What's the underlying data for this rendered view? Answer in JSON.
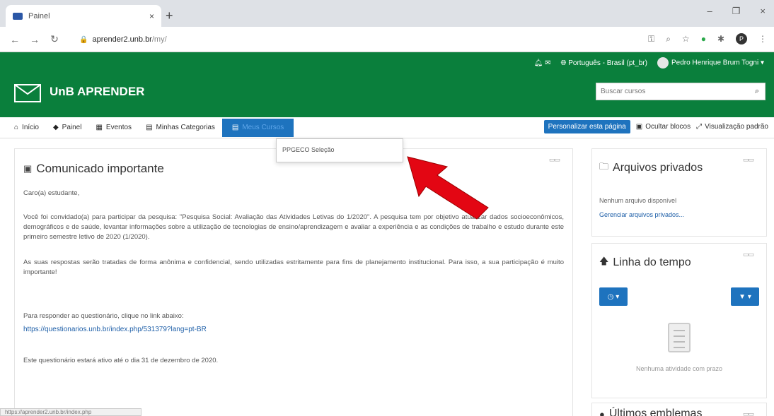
{
  "browser": {
    "tab_title": "Painel",
    "tab_close": "×",
    "new_tab": "+",
    "url_host": "aprender2.unb.br",
    "url_path": "/my/",
    "win_minimize": "–",
    "win_restore": "❐",
    "win_close": "×",
    "profile_initial": "P"
  },
  "header": {
    "language": "Português - Brasil (pt_br)",
    "user_name": "Pedro Henrique Brum Togni",
    "brand": "UnB APRENDER",
    "search_placeholder": "Buscar cursos"
  },
  "nav": {
    "items": [
      {
        "icon": "⌂",
        "label": "Início"
      },
      {
        "icon": "◆",
        "label": "Painel"
      },
      {
        "icon": "▦",
        "label": "Eventos"
      },
      {
        "icon": "▤",
        "label": "Minhas Categorias"
      },
      {
        "icon": "▤",
        "label": "Meus Cursos"
      }
    ],
    "customize_label": "Personalizar esta página",
    "hide_blocks_label": "Ocultar blocos",
    "default_view_label": "Visualização padrão"
  },
  "dropdown": {
    "item": "PPGECO Seleção"
  },
  "main": {
    "title": "Comunicado importante",
    "greeting": "Caro(a) estudante,",
    "para1": "Você foi convidado(a) para participar da pesquisa: \"Pesquisa Social: Avaliação das Atividades Letivas do 1/2020\". A pesquisa tem por objetivo atualizar dados socioeconômicos, demográficos e de saúde, levantar informações sobre a utilização de tecnologias de ensino/aprendizagem e avaliar a experiência e as condições de trabalho e estudo durante este primeiro semestre letivo de 2020 (1/2020).",
    "para2": "As suas respostas serão tratadas de forma anônima e confidencial, sendo utilizadas estritamente para fins de planejamento institucional. Para isso, a sua participação é muito importante!",
    "para3": "Para responder ao questionário, clique no link abaixo:",
    "link": "https://questionarios.unb.br/index.php/531379?lang=pt-BR",
    "para4": "Este questionário estará ativo até o dia 31 de dezembro de 2020."
  },
  "sidebar": {
    "files_title": "Arquivos privados",
    "files_empty": "Nenhum arquivo disponível",
    "files_manage": "Gerenciar arquivos privados...",
    "timeline_title": "Linha do tempo",
    "timeline_empty": "Nenhuma atividade com prazo",
    "badges_title": "Últimos emblemas"
  },
  "statusbar": {
    "text": "https://aprender2.unb.br/index.php"
  },
  "colors": {
    "brand_green": "#0a7f3c",
    "accent_blue": "#1e73be",
    "arrow_red": "#e30613"
  }
}
